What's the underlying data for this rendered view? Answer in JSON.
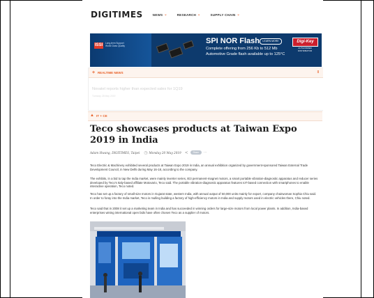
{
  "header": {
    "logo": "DIGITIMES",
    "nav": [
      {
        "label": "NEWS"
      },
      {
        "label": "RESEARCH"
      },
      {
        "label": "SUPPLY CHAIN"
      }
    ]
  },
  "ad": {
    "brand": "ISSI",
    "tagline": "Long-term Support World Class Quality",
    "title": "SPI NOR Flash",
    "button": "LEARN MORE",
    "line1": "Complete offering from 256 Kb to 512 Mb",
    "line2": "Automotive Grade flash available up to 125°C",
    "partner": "Digi-Key",
    "partner_sub": "AUTHORIZED DISTRIBUTOR"
  },
  "realtime": {
    "label": "REALTIME NEWS",
    "headline": "Novatel reports higher than expected sales for 1Q19",
    "sub": "Tuesday 28 May 2019"
  },
  "section": {
    "label": "IT + CE"
  },
  "article": {
    "title": "Teco showcases products at Taiwan Expo 2019 in India",
    "author": "Adam Hwang, DIGITIMES, Taipei",
    "date": "Monday 20 May 2019",
    "pill": "Share",
    "paragraphs": [
      "Teco Electric & Machinery exhibited several products at Taiwan Expo 2019 in India, an annual exhibition organized by government-sponsored Taiwan External Trade Development Council, in New Delhi during May 16-18, according to the company.",
      "The exhibits, in a bid to tap the India market, were mainly inverter series, IE3 permanent-magnet motors, a smart portable vibration-diagnostic apparatus and reducer series developed by Teco's Italy-based affiliate Motovario, Teco said. The portable vibration-diagnostic apparatus features IoT-based connection with smartphones to enable interactive operation, Teco noted.",
      "Teco has set up a factory of small-size motors in Gujarat state, western India, with annual output of 50,000 units mainly for export, company chairwoman Sophia Chiu said. In order to foray into the India market, Teco is mulling building a factory of high-efficiency motors in India and supply motors used in electric vehicles there, Chiu noted.",
      "Teco said that in 2008 it set up a marketing team in India and has succeeded in winning orders for large-size motors from local power plants. In addition, India-based enterprises wining international open bids have often chosen Teco as a supplier of motors."
    ]
  }
}
